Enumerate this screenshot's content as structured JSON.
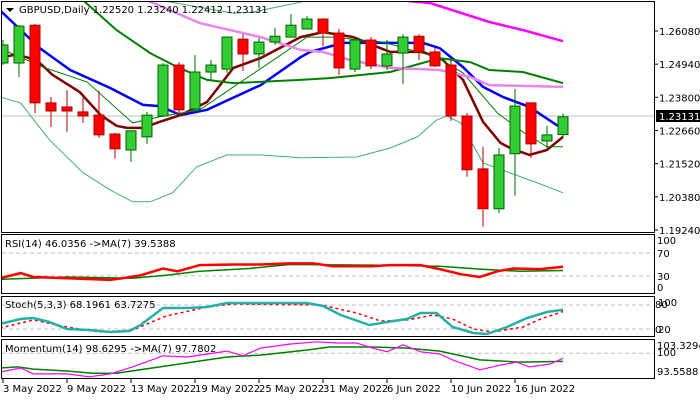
{
  "header": {
    "symbol": "GBPUSD,Daily",
    "open": "1.22520",
    "high": "1.23240",
    "low": "1.22412",
    "close": "1.23131"
  },
  "colors": {
    "bull": "#32CD32",
    "bull_border": "#006400",
    "bear": "#FF0000",
    "bear_border": "#B00000",
    "blue": "#0000FF",
    "maroon": "#800000",
    "green": "#008000",
    "bb": "#3CB371",
    "violet": "#EE82EE",
    "magenta": "#FF00FF",
    "teal": "#20B2AA"
  },
  "price_axis": {
    "ticks": [
      "1.26080",
      "1.24940",
      "1.23800",
      "1.22660",
      "1.21520",
      "1.20380",
      "1.19240"
    ],
    "current": "1.23131"
  },
  "candles": [
    [
      1.2498,
      1.2577,
      1.2491,
      1.256
    ],
    [
      1.2498,
      1.2628,
      1.245,
      1.2625
    ],
    [
      1.2628,
      1.2632,
      1.2326,
      1.2361
    ],
    [
      1.2361,
      1.2381,
      1.2278,
      1.2333
    ],
    [
      1.2347,
      1.2405,
      1.2261,
      1.2333
    ],
    [
      1.233,
      1.2378,
      1.2292,
      1.2316
    ],
    [
      1.2319,
      1.2402,
      1.2241,
      1.2251
    ],
    [
      1.2254,
      1.2258,
      1.2169,
      1.2203
    ],
    [
      1.2199,
      1.2265,
      1.2158,
      1.2265
    ],
    [
      1.2244,
      1.233,
      1.222,
      1.2319
    ],
    [
      1.2316,
      1.2498,
      1.2313,
      1.2491
    ],
    [
      1.2491,
      1.2501,
      1.2326,
      1.2337
    ],
    [
      1.234,
      1.2525,
      1.2333,
      1.2467
    ],
    [
      1.2467,
      1.2508,
      1.244,
      1.2491
    ],
    [
      1.2477,
      1.259,
      1.2464,
      1.2587
    ],
    [
      1.258,
      1.2597,
      1.247,
      1.2529
    ],
    [
      1.2529,
      1.2584,
      1.2481,
      1.257
    ],
    [
      1.257,
      1.2618,
      1.256,
      1.259
    ],
    [
      1.2587,
      1.2666,
      1.2587,
      1.2628
    ],
    [
      1.2615,
      1.2659,
      1.2615,
      1.2649
    ],
    [
      1.2649,
      1.2652,
      1.2556,
      1.2601
    ],
    [
      1.2601,
      1.2615,
      1.2457,
      1.2481
    ],
    [
      1.2477,
      1.2584,
      1.2467,
      1.2577
    ],
    [
      1.2577,
      1.2587,
      1.2477,
      1.2488
    ],
    [
      1.2488,
      1.2577,
      1.2474,
      1.2529
    ],
    [
      1.2532,
      1.2597,
      1.2426,
      1.2587
    ],
    [
      1.259,
      1.2597,
      1.2508,
      1.2536
    ],
    [
      1.2536,
      1.2549,
      1.2484,
      1.2488
    ],
    [
      1.2491,
      1.2508,
      1.2299,
      1.2316
    ],
    [
      1.2316,
      1.2326,
      1.2107,
      1.2131
    ],
    [
      1.2134,
      1.221,
      1.1935,
      1.1997
    ],
    [
      1.1997,
      1.2206,
      1.1983,
      1.2182
    ],
    [
      1.2186,
      1.2409,
      1.2042,
      1.235
    ],
    [
      1.2361,
      1.2361,
      1.2172,
      1.222
    ],
    [
      1.223,
      1.2282,
      1.2203,
      1.2251
    ],
    [
      1.2252,
      1.2324,
      1.22412,
      1.23131
    ]
  ],
  "overlays": [
    {
      "name": "blue-ma-line",
      "color": "blue",
      "width": 2.5,
      "points": [
        [
          -0.2,
          1.268
        ],
        [
          2.3,
          1.2549
        ],
        [
          4.2,
          1.2474
        ],
        [
          6.7,
          1.2412
        ],
        [
          8.75,
          1.2354
        ],
        [
          9.8,
          1.235
        ],
        [
          11.1,
          1.2319
        ],
        [
          12.75,
          1.2337
        ],
        [
          16.1,
          1.2422
        ],
        [
          18.6,
          1.2518
        ],
        [
          19.2,
          1.2536
        ],
        [
          21.25,
          1.2567
        ],
        [
          26.25,
          1.2567
        ],
        [
          27.3,
          1.2549
        ],
        [
          28.75,
          1.2484
        ],
        [
          30,
          1.2416
        ],
        [
          31.25,
          1.2381
        ],
        [
          32.9,
          1.2347
        ],
        [
          34.6,
          1.2285
        ],
        [
          35,
          1.2275
        ]
      ]
    },
    {
      "name": "maroon-ma-line",
      "color": "maroon",
      "width": 2.5,
      "points": [
        [
          -0.2,
          1.2515
        ],
        [
          0.6,
          1.2525
        ],
        [
          1.5,
          1.2518
        ],
        [
          2.3,
          1.2498
        ],
        [
          3.1,
          1.2457
        ],
        [
          4.8,
          1.2398
        ],
        [
          6.1,
          1.2319
        ],
        [
          7.1,
          1.2282
        ],
        [
          7.75,
          1.2275
        ],
        [
          8.75,
          1.2275
        ],
        [
          9.8,
          1.2296
        ],
        [
          11.1,
          1.2319
        ],
        [
          12.75,
          1.2364
        ],
        [
          14.4,
          1.2481
        ],
        [
          16.1,
          1.2515
        ],
        [
          18.6,
          1.2587
        ],
        [
          20,
          1.2604
        ],
        [
          21.9,
          1.2587
        ],
        [
          23.4,
          1.2553
        ],
        [
          24.2,
          1.2536
        ],
        [
          26.25,
          1.2536
        ],
        [
          27.5,
          1.2508
        ],
        [
          28.75,
          1.244
        ],
        [
          30,
          1.2296
        ],
        [
          31.1,
          1.2223
        ],
        [
          31.7,
          1.2206
        ],
        [
          32.9,
          1.2182
        ],
        [
          34,
          1.2199
        ],
        [
          35,
          1.2244
        ]
      ]
    },
    {
      "name": "thin-green-ma-line",
      "color": "green",
      "width": 1,
      "points": [
        [
          -0.2,
          1.2549
        ],
        [
          2.5,
          1.2484
        ],
        [
          5.25,
          1.2433
        ],
        [
          8.1,
          1.2292
        ],
        [
          9.8,
          1.2313
        ],
        [
          12.3,
          1.2337
        ],
        [
          14.4,
          1.2416
        ],
        [
          16.9,
          1.2508
        ],
        [
          19,
          1.2587
        ],
        [
          20.6,
          1.2587
        ],
        [
          23.75,
          1.257
        ],
        [
          27.1,
          1.2518
        ],
        [
          28.75,
          1.2464
        ],
        [
          30.9,
          1.2326
        ],
        [
          32.5,
          1.2261
        ],
        [
          34,
          1.221
        ],
        [
          35,
          1.221
        ]
      ]
    },
    {
      "name": "bollinger-middle-line",
      "color": "green",
      "width": 2,
      "points": [
        [
          5,
          1.2714
        ],
        [
          7.1,
          1.2611
        ],
        [
          9.2,
          1.2532
        ],
        [
          10.9,
          1.2484
        ],
        [
          12.75,
          1.244
        ],
        [
          14.4,
          1.2429
        ],
        [
          18.6,
          1.244
        ],
        [
          20.4,
          1.2446
        ],
        [
          24.2,
          1.2467
        ],
        [
          27.3,
          1.2515
        ],
        [
          29.2,
          1.2501
        ],
        [
          30.4,
          1.2474
        ],
        [
          32.5,
          1.2467
        ],
        [
          35,
          1.2429
        ]
      ]
    },
    {
      "name": "bollinger-upper-line",
      "color": "bb",
      "width": 1,
      "points": [
        [
          9.8,
          1.2714
        ],
        [
          14.4,
          1.2669
        ],
        [
          15.6,
          1.2673
        ],
        [
          18.6,
          1.2707
        ],
        [
          19.5,
          1.2731
        ]
      ]
    },
    {
      "name": "bollinger-lower-line",
      "color": "bb",
      "width": 1,
      "points": [
        [
          -0.2,
          1.2381
        ],
        [
          1.1,
          1.2361
        ],
        [
          2.9,
          1.2234
        ],
        [
          5,
          1.2121
        ],
        [
          6.7,
          1.2062
        ],
        [
          8.1,
          1.2021
        ],
        [
          9.2,
          1.2021
        ],
        [
          10.6,
          1.2052
        ],
        [
          12.1,
          1.2141
        ],
        [
          14,
          1.2182
        ],
        [
          16.1,
          1.2182
        ],
        [
          18.6,
          1.2172
        ],
        [
          22.1,
          1.2175
        ],
        [
          24.2,
          1.2206
        ],
        [
          25.9,
          1.2244
        ],
        [
          27.1,
          1.2302
        ],
        [
          27.75,
          1.2316
        ],
        [
          28.6,
          1.2292
        ],
        [
          30,
          1.2155
        ],
        [
          31.5,
          1.2124
        ],
        [
          33.4,
          1.2086
        ],
        [
          35,
          1.2052
        ]
      ]
    },
    {
      "name": "violet-ma-line",
      "color": "violet",
      "width": 2.5,
      "points": [
        [
          9,
          1.2714
        ],
        [
          12.3,
          1.2635
        ],
        [
          16.1,
          1.2587
        ],
        [
          18.6,
          1.2543
        ],
        [
          20,
          1.2536
        ],
        [
          21.7,
          1.2508
        ],
        [
          24.2,
          1.2481
        ],
        [
          27.3,
          1.2474
        ],
        [
          29.2,
          1.245
        ],
        [
          30.4,
          1.2422
        ],
        [
          35,
          1.2416
        ]
      ]
    },
    {
      "name": "magenta-ma-line",
      "color": "magenta",
      "width": 2.5,
      "points": [
        [
          23.6,
          1.2721
        ],
        [
          26.7,
          1.2704
        ],
        [
          30.4,
          1.2639
        ],
        [
          32.5,
          1.2611
        ],
        [
          35,
          1.2573
        ]
      ]
    }
  ],
  "rsi": {
    "label": "RSI(14) 46.0356  ->MA(7) 39.5388",
    "levels": [
      "100",
      "70",
      "30",
      "0"
    ],
    "line": [
      [
        -0.2,
        26
      ],
      [
        1.1,
        35
      ],
      [
        1.9,
        28
      ],
      [
        4,
        26
      ],
      [
        6.7,
        23
      ],
      [
        7.5,
        26
      ],
      [
        8.6,
        31
      ],
      [
        10,
        43
      ],
      [
        10.9,
        38
      ],
      [
        12.3,
        49
      ],
      [
        14.4,
        50
      ],
      [
        16.1,
        50
      ],
      [
        17.9,
        52
      ],
      [
        19.4,
        52
      ],
      [
        20.6,
        47
      ],
      [
        23.1,
        47
      ],
      [
        24.2,
        49
      ],
      [
        26.1,
        49
      ],
      [
        27.3,
        42
      ],
      [
        28.6,
        33
      ],
      [
        29.8,
        28
      ],
      [
        30.9,
        38
      ],
      [
        31.9,
        43
      ],
      [
        33.6,
        42
      ],
      [
        35,
        46.04
      ]
    ],
    "ma": [
      [
        -0.2,
        24
      ],
      [
        4,
        28
      ],
      [
        8.1,
        26
      ],
      [
        10.2,
        31
      ],
      [
        12.3,
        38
      ],
      [
        15.4,
        43
      ],
      [
        17.9,
        50
      ],
      [
        23.1,
        49
      ],
      [
        27.3,
        47
      ],
      [
        29.8,
        42
      ],
      [
        32.3,
        38
      ],
      [
        35,
        39.54
      ]
    ]
  },
  "stoch": {
    "label": "Stoch(5,3,3) 68.1961 63.7275",
    "levels": [
      "100",
      "80",
      "20",
      "0"
    ],
    "main": [
      [
        -0.2,
        32.5
      ],
      [
        1.1,
        45
      ],
      [
        1.9,
        47.5
      ],
      [
        2.9,
        37.5
      ],
      [
        4,
        20
      ],
      [
        5.4,
        17.5
      ],
      [
        6.7,
        12.5
      ],
      [
        7.9,
        15
      ],
      [
        8.6,
        30
      ],
      [
        10,
        72.5
      ],
      [
        11.5,
        72.5
      ],
      [
        12.75,
        75
      ],
      [
        14,
        85
      ],
      [
        15.4,
        85
      ],
      [
        19,
        85
      ],
      [
        20,
        77.5
      ],
      [
        21.1,
        55
      ],
      [
        22.9,
        30
      ],
      [
        24,
        37.5
      ],
      [
        25.25,
        45
      ],
      [
        26.1,
        60
      ],
      [
        27.1,
        60
      ],
      [
        28.1,
        25
      ],
      [
        29.4,
        10
      ],
      [
        30.25,
        7.5
      ],
      [
        31.5,
        25
      ],
      [
        32.75,
        47.5
      ],
      [
        34,
        62.5
      ],
      [
        35,
        68.2
      ]
    ],
    "signal": [
      [
        -0.2,
        22.5
      ],
      [
        1.9,
        42.5
      ],
      [
        4,
        25
      ],
      [
        6,
        12.5
      ],
      [
        8.1,
        17.5
      ],
      [
        10.2,
        52.5
      ],
      [
        12.75,
        75
      ],
      [
        14.4,
        82.5
      ],
      [
        19.9,
        80
      ],
      [
        22.1,
        60
      ],
      [
        23.6,
        40
      ],
      [
        25.25,
        42.5
      ],
      [
        26.9,
        55
      ],
      [
        28.1,
        45
      ],
      [
        29.4,
        20
      ],
      [
        30.6,
        12.5
      ],
      [
        32.5,
        25
      ],
      [
        33.6,
        45
      ],
      [
        35,
        63.7
      ]
    ]
  },
  "momentum": {
    "label": "Momentum(14) 98.6295  ->MA(7) 97.7802",
    "levels": [
      "103.3294",
      "100",
      "93.5588"
    ],
    "line": [
      [
        -0.2,
        94.9
      ],
      [
        1.1,
        96
      ],
      [
        1.9,
        94.4
      ],
      [
        4,
        94.4
      ],
      [
        5.4,
        93.6
      ],
      [
        6.7,
        94.4
      ],
      [
        8.1,
        96.3
      ],
      [
        10,
        99.3
      ],
      [
        11.5,
        99
      ],
      [
        14,
        100.6
      ],
      [
        15,
        99.3
      ],
      [
        16.1,
        101.4
      ],
      [
        17.9,
        102.5
      ],
      [
        19.6,
        103.1
      ],
      [
        20.9,
        102.8
      ],
      [
        22.1,
        102.8
      ],
      [
        23.1,
        101.4
      ],
      [
        24,
        100.4
      ],
      [
        25,
        102.3
      ],
      [
        26.1,
        100.4
      ],
      [
        27.3,
        99.8
      ],
      [
        28.1,
        98.2
      ],
      [
        29.8,
        95.5
      ],
      [
        31.1,
        96.8
      ],
      [
        32.1,
        97.6
      ],
      [
        32.9,
        96.3
      ],
      [
        34.2,
        97.1
      ],
      [
        35,
        98.63
      ]
    ],
    "ma": [
      [
        -0.2,
        96
      ],
      [
        0.9,
        96.3
      ],
      [
        1.9,
        95.7
      ],
      [
        4,
        95.2
      ],
      [
        5.6,
        94.6
      ],
      [
        7.1,
        94.6
      ],
      [
        9.8,
        96.3
      ],
      [
        12.3,
        97.9
      ],
      [
        14,
        99
      ],
      [
        16.1,
        99.5
      ],
      [
        19,
        100.9
      ],
      [
        20.4,
        101.7
      ],
      [
        23.1,
        101.7
      ],
      [
        25.25,
        101.4
      ],
      [
        27.3,
        100.6
      ],
      [
        29.8,
        98.2
      ],
      [
        32.3,
        97.6
      ],
      [
        35,
        97.78
      ]
    ]
  },
  "dates": [
    {
      "index": 0,
      "label": "3 May 2022"
    },
    {
      "index": 4,
      "label": "9 May 2022"
    },
    {
      "index": 8,
      "label": "13 May 2022"
    },
    {
      "index": 12,
      "label": "19 May 2022"
    },
    {
      "index": 16,
      "label": "25 May 2022"
    },
    {
      "index": 20,
      "label": "31 May 2022"
    },
    {
      "index": 24,
      "label": "6 Jun 2022"
    },
    {
      "index": 28,
      "label": "10 Jun 2022"
    },
    {
      "index": 32,
      "label": "16 Jun 2022"
    }
  ]
}
